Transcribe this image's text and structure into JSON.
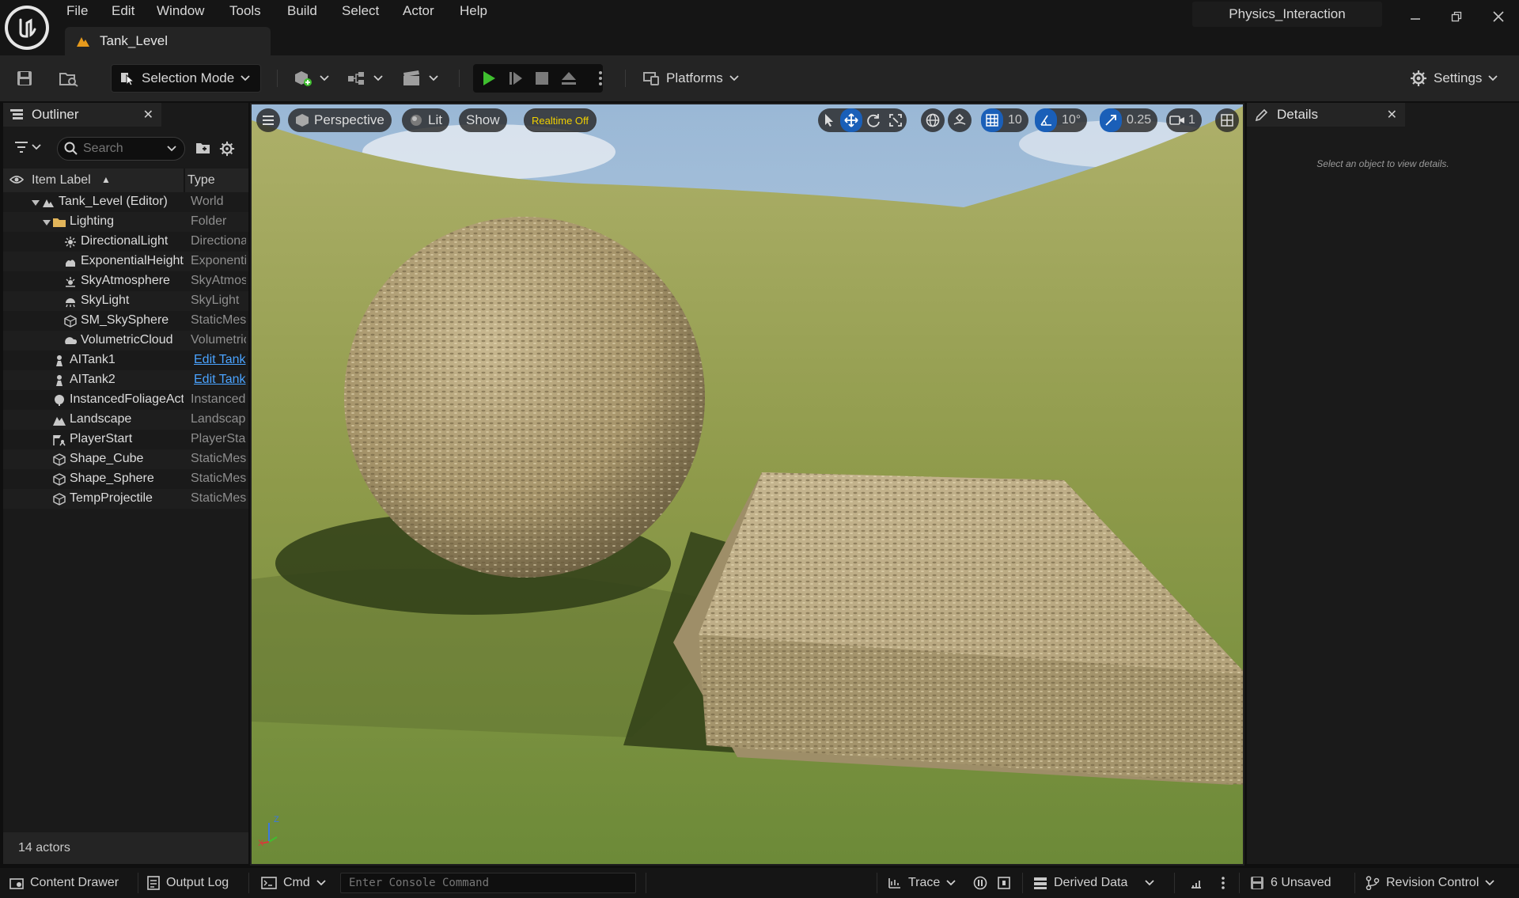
{
  "menu": [
    "File",
    "Edit",
    "Window",
    "Tools",
    "Build",
    "Select",
    "Actor",
    "Help"
  ],
  "document_tab": "Tank_Level",
  "project_name": "Physics_Interaction",
  "toolbar": {
    "selection_mode": "Selection Mode",
    "platforms": "Platforms",
    "settings": "Settings"
  },
  "outliner": {
    "title": "Outliner",
    "search_placeholder": "Search",
    "col_label": "Item Label",
    "col_type": "Type",
    "rows": [
      {
        "label": "Tank_Level (Editor)",
        "type": "World",
        "icon": "level-icon"
      },
      {
        "label": "Lighting",
        "type": "Folder",
        "icon": "folder-icon"
      },
      {
        "label": "DirectionalLight",
        "type": "DirectionalLight",
        "icon": "sun-icon"
      },
      {
        "label": "ExponentialHeightFog",
        "type": "ExponentialHeightFog",
        "icon": "fog-icon"
      },
      {
        "label": "SkyAtmosphere",
        "type": "SkyAtmosphere",
        "icon": "sky-atmosphere-icon"
      },
      {
        "label": "SkyLight",
        "type": "SkyLight",
        "icon": "skylight-icon"
      },
      {
        "label": "SM_SkySphere",
        "type": "StaticMeshActor",
        "icon": "static-mesh-icon"
      },
      {
        "label": "VolumetricCloud",
        "type": "VolumetricCloud",
        "icon": "cloud-icon"
      },
      {
        "label": "AITank1",
        "type": "Edit Tank",
        "icon": "pawn-icon"
      },
      {
        "label": "AITank2",
        "type": "Edit Tank",
        "icon": "pawn-icon"
      },
      {
        "label": "InstancedFoliageActor",
        "type": "InstancedFoliageActor",
        "icon": "foliage-icon"
      },
      {
        "label": "Landscape",
        "type": "Landscape",
        "icon": "landscape-icon"
      },
      {
        "label": "PlayerStart",
        "type": "PlayerStart",
        "icon": "player-start-icon"
      },
      {
        "label": "Shape_Cube",
        "type": "StaticMeshActor",
        "icon": "static-mesh-icon"
      },
      {
        "label": "Shape_Sphere",
        "type": "StaticMeshActor",
        "icon": "static-mesh-icon"
      },
      {
        "label": "TempProjectile",
        "type": "StaticMeshActor",
        "icon": "static-mesh-icon"
      }
    ],
    "actor_count": "14 actors"
  },
  "viewport": {
    "perspective": "Perspective",
    "lit": "Lit",
    "show": "Show",
    "realtime": "Realtime Off",
    "grid_snap": "10",
    "rotation_snap": "10°",
    "scale_snap": "0.25",
    "camera_speed": "1",
    "axis_z": "Z",
    "axis_x": "X"
  },
  "details": {
    "title": "Details",
    "hint": "Select an object to view details."
  },
  "statusbar": {
    "content_drawer": "Content Drawer",
    "output_log": "Output Log",
    "cmd": "Cmd",
    "console_placeholder": "Enter Console Command",
    "trace": "Trace",
    "derived_data": "Derived Data",
    "unsaved": "6 Unsaved",
    "revision_control": "Revision Control"
  },
  "colors": {
    "accent_blue": "#1a5fb8",
    "play_green": "#3fbf2f",
    "realtime_yellow": "#f0d000",
    "link_blue": "#4aa3ff"
  }
}
